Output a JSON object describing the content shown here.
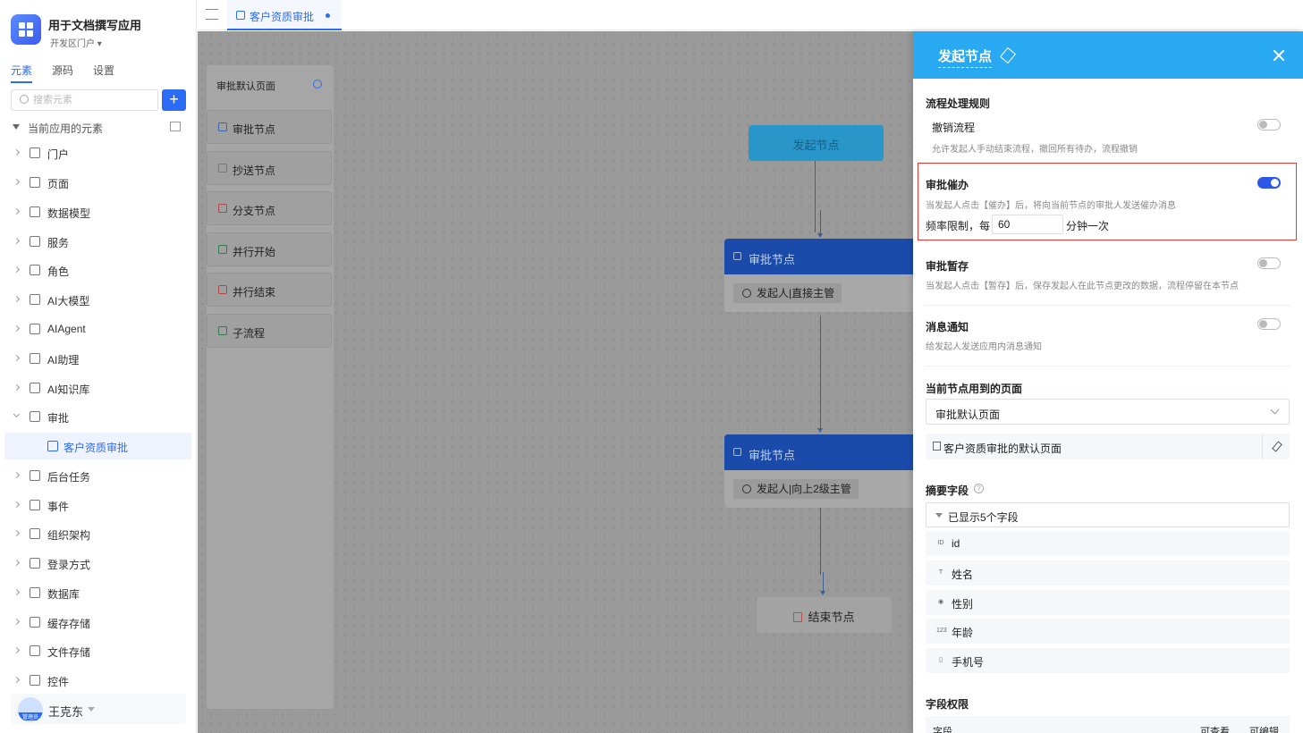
{
  "app": {
    "title": "用于文档撰写应用",
    "subtitle": "开发区门户"
  },
  "sidebar_tabs": [
    "元素",
    "源码",
    "设置"
  ],
  "search": {
    "placeholder": "搜索元素"
  },
  "tree": {
    "root_label": "当前应用的元素",
    "items": [
      "门户",
      "页面",
      "数据模型",
      "服务",
      "角色",
      "AI大模型",
      "AIAgent",
      "AI助理",
      "AI知识库",
      "审批",
      "客户资质审批",
      "后台任务",
      "事件",
      "组织架构",
      "登录方式",
      "数据库",
      "缓存存储",
      "文件存储",
      "控件"
    ]
  },
  "user": {
    "name": "王克东",
    "role": "管理员"
  },
  "tab": {
    "label": "客户资质审批"
  },
  "palette": {
    "header": "审批默认页面",
    "items": [
      "审批节点",
      "抄送节点",
      "分支节点",
      "并行开始",
      "并行结束",
      "子流程"
    ]
  },
  "flow": {
    "start": "发起节点",
    "approval1": {
      "title": "审批节点",
      "assignee": "发起人|直接主管"
    },
    "approval2": {
      "title": "审批节点",
      "assignee": "发起人|向上2级主管"
    },
    "end": "结束节点"
  },
  "panel": {
    "title": "发起节点",
    "section_rules": "流程处理规则",
    "revoke": {
      "title": "撤销流程",
      "desc": "允许发起人手动结束流程，撤回所有待办，流程撤销",
      "on": false
    },
    "urge": {
      "title": "审批催办",
      "desc": "当发起人点击【催办】后，将向当前节点的审批人发送催办消息",
      "on": true,
      "freq_label": "频率限制，每",
      "freq_value": "60",
      "freq_suffix": "分钟一次"
    },
    "draft": {
      "title": "审批暂存",
      "desc": "当发起人点击【暂存】后，保存发起人在此节点更改的数据，流程停留在本节点",
      "on": false
    },
    "notify": {
      "title": "消息通知",
      "desc": "给发起人发送应用内消息通知",
      "on": false
    },
    "section_pages": "当前节点用到的页面",
    "page_select": "审批默认页面",
    "page_item": "客户资质审批的默认页面",
    "section_summary": "摘要字段",
    "fields_head": "已显示5个字段",
    "fields": [
      {
        "icon": "ID",
        "label": "id"
      },
      {
        "icon": "T",
        "label": "姓名"
      },
      {
        "icon": "◉",
        "label": "性别"
      },
      {
        "icon": "123",
        "label": "年龄"
      },
      {
        "icon": "▯",
        "label": "手机号"
      }
    ],
    "section_perm": "字段权限",
    "perm_cols": [
      "字段",
      "可查看",
      "可编辑"
    ]
  },
  "colors": {
    "primary": "#2b6cf6",
    "panel_header": "#28a9f1",
    "highlight": "#e53935"
  }
}
